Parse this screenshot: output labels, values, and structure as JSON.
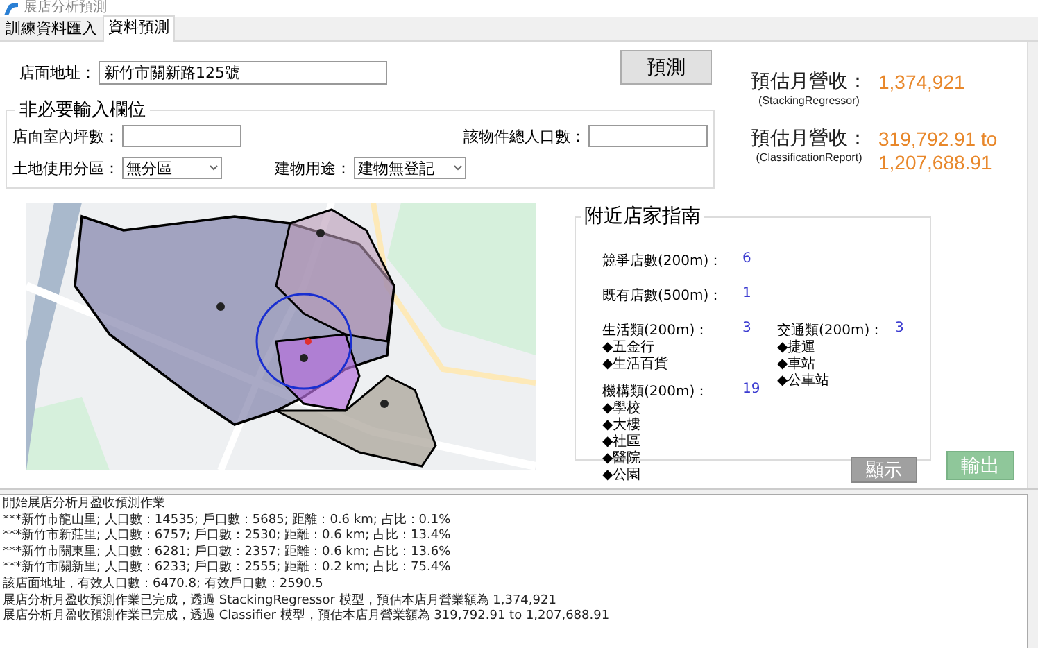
{
  "window": {
    "title": "展店分析預測"
  },
  "tabs": [
    {
      "label": "訓練資料匯入",
      "selected": false
    },
    {
      "label": "資料預測",
      "selected": true
    }
  ],
  "address": {
    "label": "店面地址：",
    "value": "新竹市關新路125號"
  },
  "predict_button": "預測",
  "optional_fields": {
    "title": "非必要輸入欄位",
    "fields": [
      {
        "kind": "input",
        "label": "店面室內坪數："
      },
      {
        "kind": "input",
        "label": "該物件總人口數："
      },
      {
        "kind": "dropdown",
        "label": "土地使用分區：",
        "value": "無分區"
      },
      {
        "kind": "dropdown",
        "label": "建物用途：",
        "value": "建物無登記"
      }
    ]
  },
  "results": [
    {
      "label": "預估月營收：",
      "model": "(StackingRegressor)",
      "value": "1,374,921"
    },
    {
      "label": "預估月營收：",
      "model": "(ClassificationReport)",
      "value": "319,792.91 to 1,207,688.91"
    }
  ],
  "nearby": {
    "title": "附近店家指南",
    "counts": [
      {
        "label": "競爭店數(200m)：",
        "value": "6"
      },
      {
        "label": "既有店數(500m)：",
        "value": "1"
      }
    ],
    "categories": [
      {
        "label": "生活類(200m)：",
        "value": "3",
        "items": [
          "◆五金行",
          "◆生活百貨"
        ]
      },
      {
        "label": "交通類(200m)：",
        "value": "3",
        "items": [
          "◆捷運",
          "◆車站",
          "◆公車站"
        ]
      },
      {
        "label": "機構類(200m)：",
        "value": "19",
        "items": [
          "◆學校",
          "◆大樓",
          "◆社區",
          "◆醫院",
          "◆公園"
        ]
      }
    ],
    "show_button": "顯示"
  },
  "export_button": "輸出",
  "log": [
    "開始展店分析月盈收預測作業",
    "***新竹市龍山里; 人口數：14535; 戶口數：5685; 距離：0.6 km; 占比：0.1%",
    "***新竹市新莊里; 人口數：6757; 戶口數：2530; 距離：0.6 km; 占比：13.4%",
    "***新竹市關東里; 人口數：6281; 戶口數：2357; 距離：0.6 km; 占比：13.6%",
    "***新竹市關新里; 人口數：6233; 戶口數：2555; 距離：0.2 km; 占比：75.4%",
    "該店面地址，有效人口數：6470.8; 有效戶口數：2590.5",
    "展店分析月盈收預測作業已完成，透過 StackingRegressor 模型，預估本店月營業額為 1,374,921",
    "展店分析月盈收預測作業已完成，透過 Classifier 模型，預估本店月營業額為 319,792.91 to 1,207,688.91"
  ]
}
